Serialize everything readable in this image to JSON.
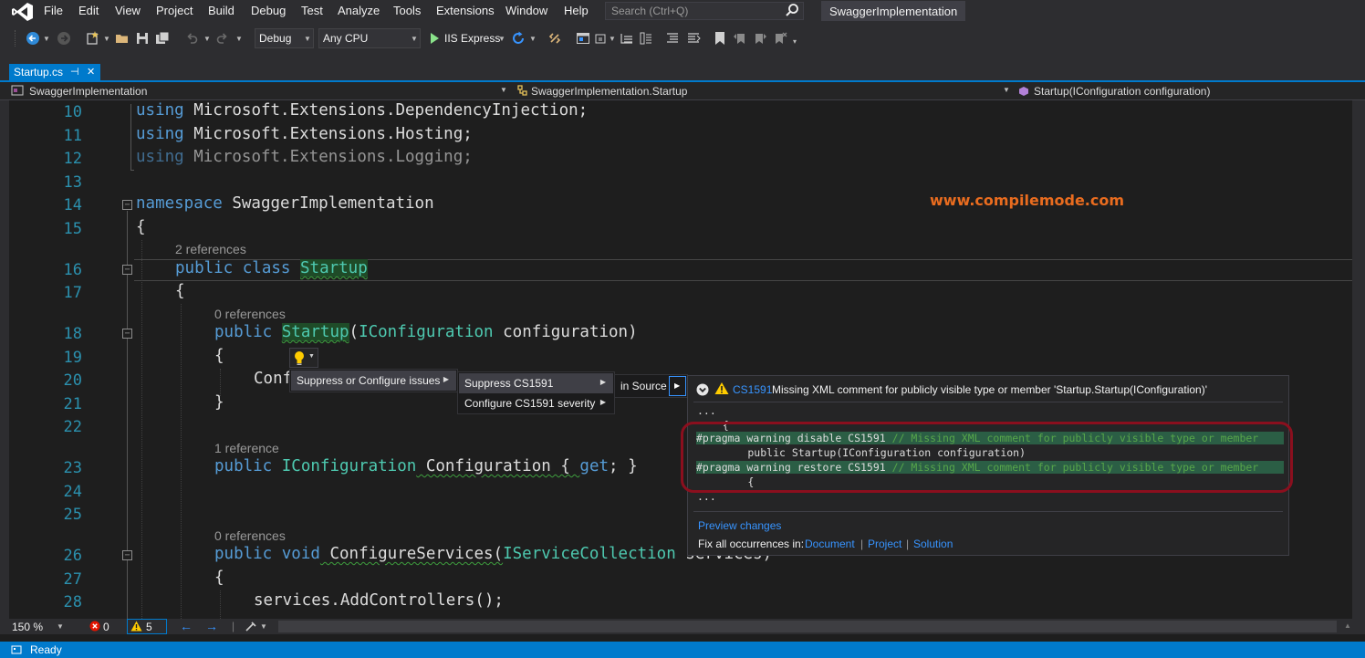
{
  "menu": {
    "items": [
      "File",
      "Edit",
      "View",
      "Project",
      "Build",
      "Debug",
      "Test",
      "Analyze",
      "Tools",
      "Extensions",
      "Window",
      "Help"
    ],
    "search_placeholder": "Search (Ctrl+Q)",
    "solution_title": "SwaggerImplementation"
  },
  "toolbar": {
    "configuration": "Debug",
    "platform": "Any CPU",
    "run_target": "IIS Express"
  },
  "tab": {
    "label": "Startup.cs",
    "pin_glyph": "⊣",
    "close_glyph": "✕"
  },
  "navbar": {
    "project": "SwaggerImplementation",
    "type": "SwaggerImplementation.Startup",
    "member": "Startup(IConfiguration configuration)"
  },
  "editor": {
    "line_numbers": [
      "10",
      "11",
      "12",
      "13",
      "14",
      "15",
      "16",
      "17",
      "18",
      "19",
      "20",
      "21",
      "22",
      "23",
      "24",
      "25",
      "26",
      "27",
      "28"
    ],
    "lines": {
      "l10": [
        "using",
        " Microsoft.Extensions.DependencyInjection;"
      ],
      "l11": [
        "using",
        " Microsoft.Extensions.Hosting;"
      ],
      "l12": [
        "using",
        " Microsoft.Extensions.Logging;"
      ],
      "l14": [
        "namespace",
        " SwaggerImplementation"
      ],
      "l15": "{",
      "l16": [
        "public",
        " ",
        "class",
        " ",
        "Startup"
      ],
      "l17": "{",
      "l18": [
        "public",
        " ",
        "Startup",
        "(",
        "IConfiguration",
        " configuration)"
      ],
      "l19": "{",
      "l20": "Conf",
      "l21": "}",
      "l23": [
        "public",
        " ",
        "IConfiguration",
        " Configuration { ",
        "get",
        "; }"
      ],
      "l26": [
        "public",
        " ",
        "void",
        " ConfigureServices(",
        "IServiceCollection",
        " services)"
      ],
      "l27": "{",
      "l28": "services.AddControllers();"
    },
    "codelens": {
      "class": "2 references",
      "ctor": "0 references",
      "prop": "1 reference",
      "method": "0 references"
    },
    "watermark": "www.compilemode.com"
  },
  "quick_actions": {
    "menu1": [
      "Suppress or Configure issues"
    ],
    "menu2": [
      "Suppress CS1591",
      "Configure CS1591 severity"
    ],
    "menu3": [
      "in Source"
    ]
  },
  "preview": {
    "code": "CS1591",
    "message": "Missing XML comment for publicly visible type or member 'Startup.Startup(IConfiguration)'",
    "lines": {
      "dots1": "...",
      "brace1": "    {",
      "pragma_disable": "#pragma warning disable CS1591",
      "pragma_comment": " // Missing XML comment for publicly visible type or member",
      "ctor_line": "        public Startup(IConfiguration configuration)",
      "pragma_restore": "#pragma warning restore CS1591",
      "brace2": "        {",
      "dots2": "..."
    },
    "preview_link": "Preview changes",
    "fix_all_label": "Fix all occurrences in:",
    "fix_document": "Document",
    "fix_project": "Project",
    "fix_solution": "Solution",
    "sep": "|"
  },
  "editor_status": {
    "zoom": "150 %",
    "errors": "0",
    "warnings": "5"
  },
  "status": {
    "text": "Ready"
  },
  "colors": {
    "accent": "#007acc",
    "keyword": "#569cd6",
    "type": "#4ec9b0",
    "comment": "#57a64a",
    "watermark": "#e96c1f"
  }
}
